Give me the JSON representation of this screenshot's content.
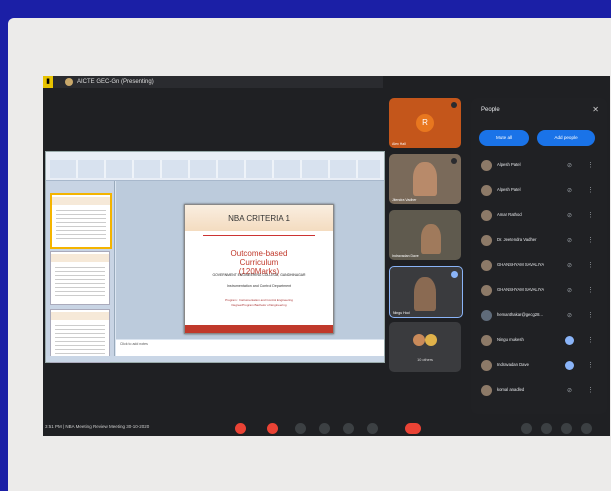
{
  "meet": {
    "presenting_title": "AICTE GEC-Gn (Presenting)",
    "meeting_info": "3:51 PM | NBA Meeting Review Meeting 30-10-2020",
    "self_initial": "R"
  },
  "slide": {
    "title": "NBA CRITERIA 1",
    "main_line1": "Outcome-based",
    "main_line2": "Curriculum",
    "main_line3": "(120Marks)",
    "college": "GOVERNMENT ENGINEERING COLLEGE, GANDHINAGAR",
    "department": "Instrumentation and Control Department",
    "program_line1": "Program : Instrumentation and Control Engineering",
    "program_line2": "Degree/Program Bachelor of Engineering",
    "notes_placeholder": "Click to add notes"
  },
  "tiles": [
    {
      "name": "Alex Hall"
    },
    {
      "name": "Jitendra Vadher"
    },
    {
      "name": "Indravadan Dave"
    },
    {
      "name": "Ningu Hod"
    },
    {
      "name": "",
      "others": "10 others"
    }
  ],
  "people_panel": {
    "title": "People",
    "close_icon": "close-icon",
    "mute_all": "Mute all",
    "add_people": "Add people",
    "participants": [
      {
        "name": "Alpesh Patel",
        "speaking": false
      },
      {
        "name": "Alpesh Patel",
        "speaking": false
      },
      {
        "name": "Amar Rathod",
        "speaking": false
      },
      {
        "name": "Dr. Jeetendra Vadher",
        "speaking": false
      },
      {
        "name": "GHANSHYAM SAVALIYA",
        "speaking": false
      },
      {
        "name": "GHANSHYAM SAVALIYA",
        "speaking": false
      },
      {
        "name": "hemanthakar@gecg28...",
        "speaking": false
      },
      {
        "name": "Ningu mukesh",
        "speaking": true
      },
      {
        "name": "Indravadan Dave",
        "speaking": true
      },
      {
        "name": "komal anadled",
        "speaking": false
      }
    ]
  },
  "colors": {
    "background": "#1b1fa6",
    "meet_dark": "#1f2023",
    "accent_blue": "#1a73e8",
    "end_call_red": "#ea4335",
    "slide_red": "#c0392b"
  }
}
